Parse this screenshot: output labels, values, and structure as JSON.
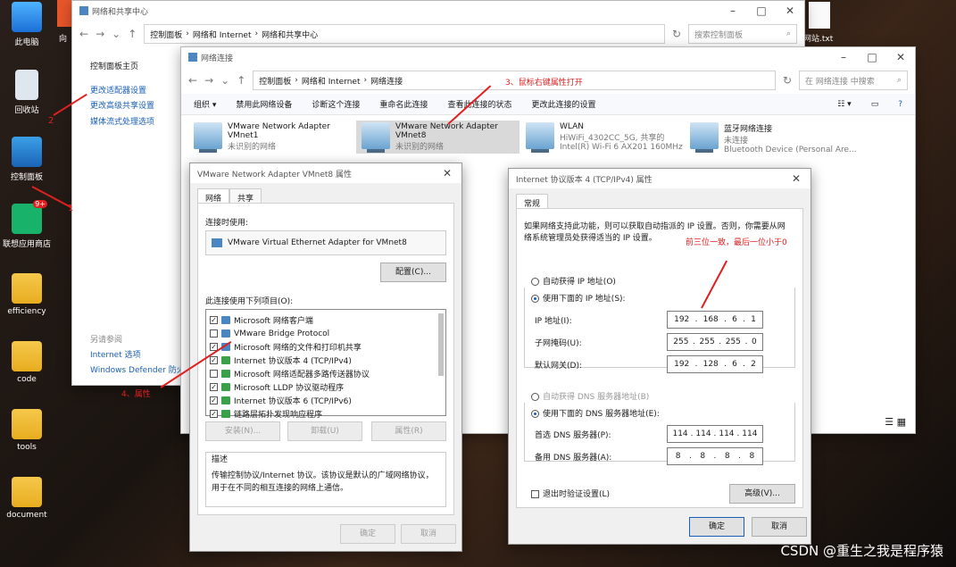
{
  "desktop": {
    "icons": [
      {
        "label": "此电脑"
      },
      {
        "label": "回收站"
      },
      {
        "label": "控制面板"
      },
      {
        "label": "联想应用商店"
      },
      {
        "label": "efficiency"
      },
      {
        "label": "code"
      },
      {
        "label": "tools"
      },
      {
        "label": "document"
      }
    ],
    "partial_left": "向",
    "partial_right": "网站.txt",
    "badge": "9+"
  },
  "win1": {
    "title": "网络和共享中心",
    "breadcrumb": [
      "控制面板",
      "网络和 Internet",
      "网络和共享中心"
    ],
    "search_placeholder": "搜索控制面板",
    "sidebar_home": "控制面板主页",
    "sidebar_links": [
      "更改适配器设置",
      "更改高级共享设置",
      "媒体流式处理选项"
    ],
    "see_also": "另请参阅",
    "see_also_links": [
      "Internet 选项",
      "Windows Defender 防火"
    ]
  },
  "win2": {
    "title": "网络连接",
    "breadcrumb": [
      "控制面板",
      "网络和 Internet",
      "网络连接"
    ],
    "search_placeholder": "在 网络连接 中搜索",
    "commands": [
      "组织 ▾",
      "禁用此网络设备",
      "诊断这个连接",
      "重命名此连接",
      "查看此连接的状态",
      "更改此连接的设置"
    ],
    "adapters": [
      {
        "name": "VMware Network Adapter VMnet1",
        "status": "未识别的网络"
      },
      {
        "name": "VMware Network Adapter VMnet8",
        "status": "未识别的网络"
      },
      {
        "name": "WLAN",
        "status": "HiWiFi_4302CC_5G, 共享的",
        "device": "Intel(R) Wi-Fi 6 AX201 160MHz"
      },
      {
        "name": "蓝牙网络连接",
        "status": "未连接",
        "device": "Bluetooth Device (Personal Are..."
      }
    ]
  },
  "dlg1": {
    "title": "VMware Network Adapter VMnet8 属性",
    "tabs": [
      "网络",
      "共享"
    ],
    "connect_using": "连接时使用:",
    "adapter_name": "VMware Virtual Ethernet Adapter for VMnet8",
    "configure": "配置(C)...",
    "items_label": "此连接使用下列项目(O):",
    "items": [
      {
        "label": "Microsoft 网络客户端",
        "checked": true
      },
      {
        "label": "VMware Bridge Protocol",
        "checked": false
      },
      {
        "label": "Microsoft 网络的文件和打印机共享",
        "checked": true
      },
      {
        "label": "Internet 协议版本 4 (TCP/IPv4)",
        "checked": true
      },
      {
        "label": "Microsoft 网络适配器多路传送器协议",
        "checked": false
      },
      {
        "label": "Microsoft LLDP 协议驱动程序",
        "checked": true
      },
      {
        "label": "Internet 协议版本 6 (TCP/IPv6)",
        "checked": true
      },
      {
        "label": "链路层拓扑发现响应程序",
        "checked": true
      }
    ],
    "install": "安装(N)...",
    "uninstall": "卸载(U)",
    "properties": "属性(R)",
    "desc_label": "描述",
    "desc_text": "传输控制协议/Internet 协议。该协议是默认的广域网络协议，用于在不同的相互连接的网络上通信。",
    "ok": "确定",
    "cancel": "取消"
  },
  "dlg2": {
    "title": "Internet 协议版本 4 (TCP/IPv4) 属性",
    "tab": "常规",
    "intro": "如果网络支持此功能，则可以获取自动指派的 IP 设置。否则，你需要从网络系统管理员处获得适当的 IP 设置。",
    "auto_ip": "自动获得 IP 地址(O)",
    "manual_ip": "使用下面的 IP 地址(S):",
    "ip_label": "IP 地址(I):",
    "ip": [
      "192",
      "168",
      "6",
      "1"
    ],
    "mask_label": "子网掩码(U):",
    "mask": [
      "255",
      "255",
      "255",
      "0"
    ],
    "gw_label": "默认网关(D):",
    "gw": [
      "192",
      "128",
      "6",
      "2"
    ],
    "auto_dns": "自动获得 DNS 服务器地址(B)",
    "manual_dns": "使用下面的 DNS 服务器地址(E):",
    "dns1_label": "首选 DNS 服务器(P):",
    "dns1": [
      "114",
      "114",
      "114",
      "114"
    ],
    "dns2_label": "备用 DNS 服务器(A):",
    "dns2": [
      "8",
      "8",
      "8",
      "8"
    ],
    "validate": "退出时验证设置(L)",
    "advanced": "高级(V)...",
    "ok": "确定",
    "cancel": "取消"
  },
  "annotations": {
    "a1": "1",
    "a2": "2",
    "a3": "3、鼠标右键属性打开",
    "a4": "4、属性",
    "a5": "前三位一致，最后一位小于0"
  },
  "watermark": "CSDN @重生之我是程序猿",
  "colors": {
    "annotation": "#e02020",
    "link": "#1a5fb4"
  }
}
